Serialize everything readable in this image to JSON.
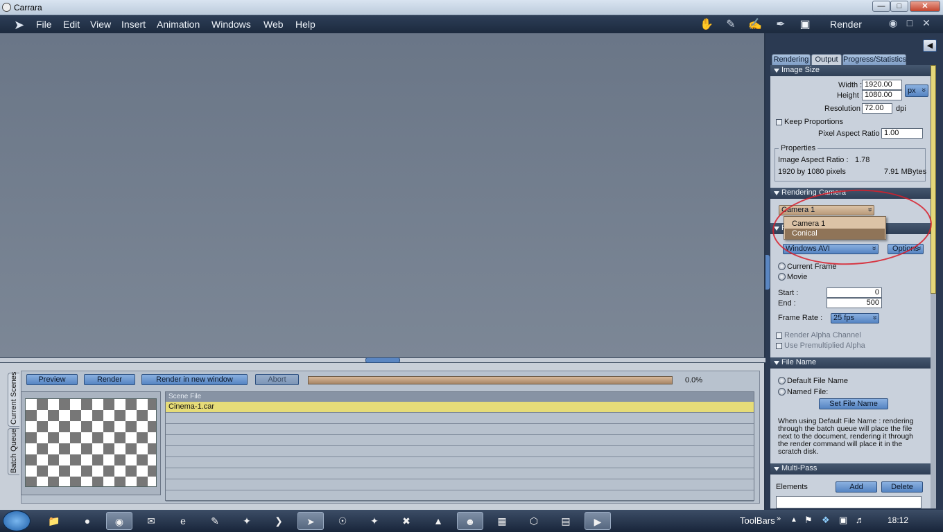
{
  "window": {
    "title": "Carrara",
    "minimize": "—",
    "maximize": "□",
    "close": "✕"
  },
  "menu": {
    "items": [
      "File",
      "Edit",
      "View",
      "Insert",
      "Animation",
      "Windows",
      "Web",
      "Help"
    ]
  },
  "room": {
    "name": "Render",
    "tools": [
      "assemble-icon",
      "model-icon",
      "storyboard-icon",
      "texture-icon",
      "render-icon"
    ]
  },
  "bottom": {
    "vtabs": [
      "Current Scenes",
      "Batch Queue"
    ],
    "buttons": {
      "preview": "Preview",
      "render": "Render",
      "render_window": "Render in new window",
      "abort": "Abort"
    },
    "progress_percent": 0,
    "progress_text": "0.0%",
    "list_header": "Scene File",
    "scenes": [
      "Cinema-1.car"
    ]
  },
  "render_panel": {
    "tabs": [
      "Rendering",
      "Output",
      "Progress/Statistics"
    ],
    "active_tab": "Output",
    "image_size": {
      "title": "Image Size",
      "width_label": "Width :",
      "width": "1920.00",
      "height_label": "Height :",
      "height": "1080.00",
      "unit": "px",
      "resolution_label": "Resolution :",
      "resolution": "72.00",
      "resolution_unit": "dpi",
      "keep_proportions": "Keep Proportions",
      "par_label": "Pixel Aspect Ratio :",
      "par": "1.00",
      "properties_title": "Properties",
      "iar_label": "Image Aspect Ratio :",
      "iar": "1.78",
      "pixels": "1920 by 1080 pixels",
      "size": "7.91 MBytes"
    },
    "camera": {
      "title": "Rendering Camera",
      "selected": "Camera 1",
      "options": [
        "Camera 1",
        "Conical"
      ],
      "highlighted": "Conical"
    },
    "file_format": {
      "title_fragment": "F",
      "format": "Windows AVI",
      "options_button": "Options",
      "current_frame": "Current Frame",
      "movie": "Movie",
      "start_label": "Start :",
      "start": "0",
      "end_label": "End :",
      "end": "500",
      "frame_rate_label": "Frame Rate :",
      "frame_rate": "25 fps",
      "alpha": "Render Alpha Channel",
      "premult": "Use Premultiplied Alpha"
    },
    "file_name": {
      "title": "File Name",
      "default": "Default File Name",
      "named": "Named File:",
      "set_button": "Set File Name",
      "note": "When using Default File Name : rendering through the batch queue will place the file next to the document, rendering it through the render command will place it in the scratch disk."
    },
    "multipass": {
      "title": "Multi-Pass",
      "elements": "Elements",
      "add": "Add",
      "delete": "Delete"
    }
  },
  "taskbar": {
    "apps": [
      "explorer-icon",
      "chrome-icon",
      "firefox-icon",
      "thunderbird-icon",
      "ie-icon",
      "paint-icon",
      "daz-icon",
      "powershell-icon",
      "carrara-icon",
      "blender-icon",
      "daz-studio-icon",
      "acrobat-icon",
      "bryce-icon",
      "gimp-icon",
      "excel-icon",
      "hexagon-icon",
      "notepad-icon",
      "media-icon"
    ],
    "active": "carrara-icon",
    "toolbars": "ToolBars",
    "clock": "18:12"
  },
  "colors": {
    "accent": "#5584c2",
    "highlight_row": "#e6dc78",
    "annotation": "#d81f2a"
  }
}
